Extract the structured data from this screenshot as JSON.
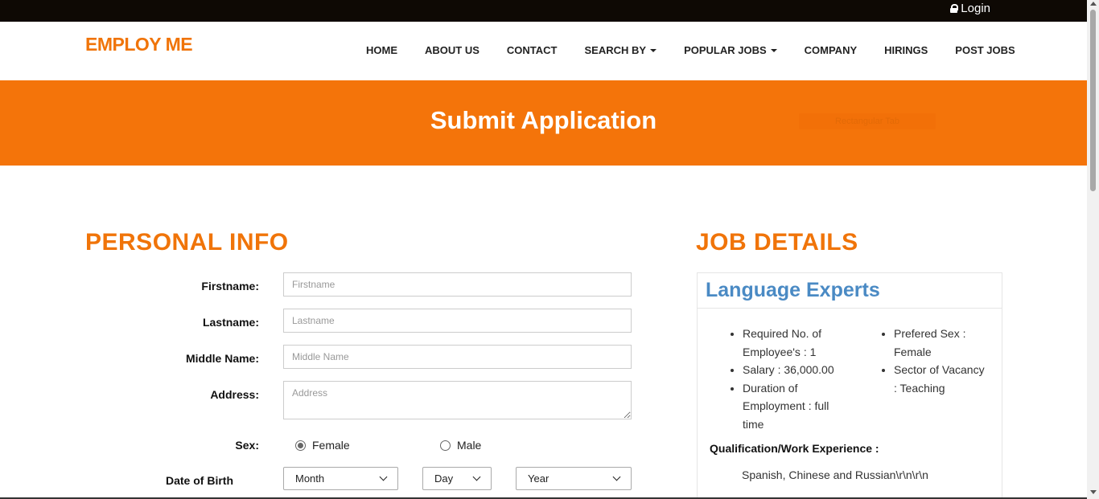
{
  "topbar": {
    "login_label": "Login"
  },
  "navbar": {
    "brand": "EMPLOY ME",
    "items": [
      {
        "label": "HOME",
        "dropdown": false
      },
      {
        "label": "ABOUT US",
        "dropdown": false
      },
      {
        "label": "CONTACT",
        "dropdown": false
      },
      {
        "label": "SEARCH BY",
        "dropdown": true
      },
      {
        "label": "POPULAR JOBS",
        "dropdown": true
      },
      {
        "label": "COMPANY",
        "dropdown": false
      },
      {
        "label": "HIRINGS",
        "dropdown": false
      },
      {
        "label": "POST JOBS",
        "dropdown": false
      }
    ]
  },
  "banner": {
    "title": "Submit Application",
    "ghost_button": "Rectangular Tab"
  },
  "personal": {
    "heading": "PERSONAL INFO",
    "firstname": {
      "label": "Firstname:",
      "placeholder": "Firstname"
    },
    "lastname": {
      "label": "Lastname:",
      "placeholder": "Lastname"
    },
    "middlename": {
      "label": "Middle Name:",
      "placeholder": "Middle Name"
    },
    "address": {
      "label": "Address:",
      "placeholder": "Address"
    },
    "sex": {
      "label": "Sex:",
      "options": [
        "Female",
        "Male"
      ],
      "selected": "Female"
    },
    "dob": {
      "label": "Date of Birth",
      "month": "Month",
      "day": "Day",
      "year": "Year"
    }
  },
  "job": {
    "heading": "JOB DETAILS",
    "title": "Language Experts",
    "col1": [
      "Required No. of Employee's : 1",
      "Salary : 36,000.00",
      "Duration of Employment : full time"
    ],
    "col2": [
      "Prefered Sex : Female",
      "Sector of Vacancy : Teaching"
    ],
    "qualification_label": "Qualification/Work Experience :",
    "qualification_value": "Spanish, Chinese and Russian\\r\\n\\r\\n"
  },
  "colors": {
    "accent": "#f07409",
    "banner": "#f4740a",
    "job_title": "#4a8ac4",
    "topbar": "#0e0904"
  }
}
